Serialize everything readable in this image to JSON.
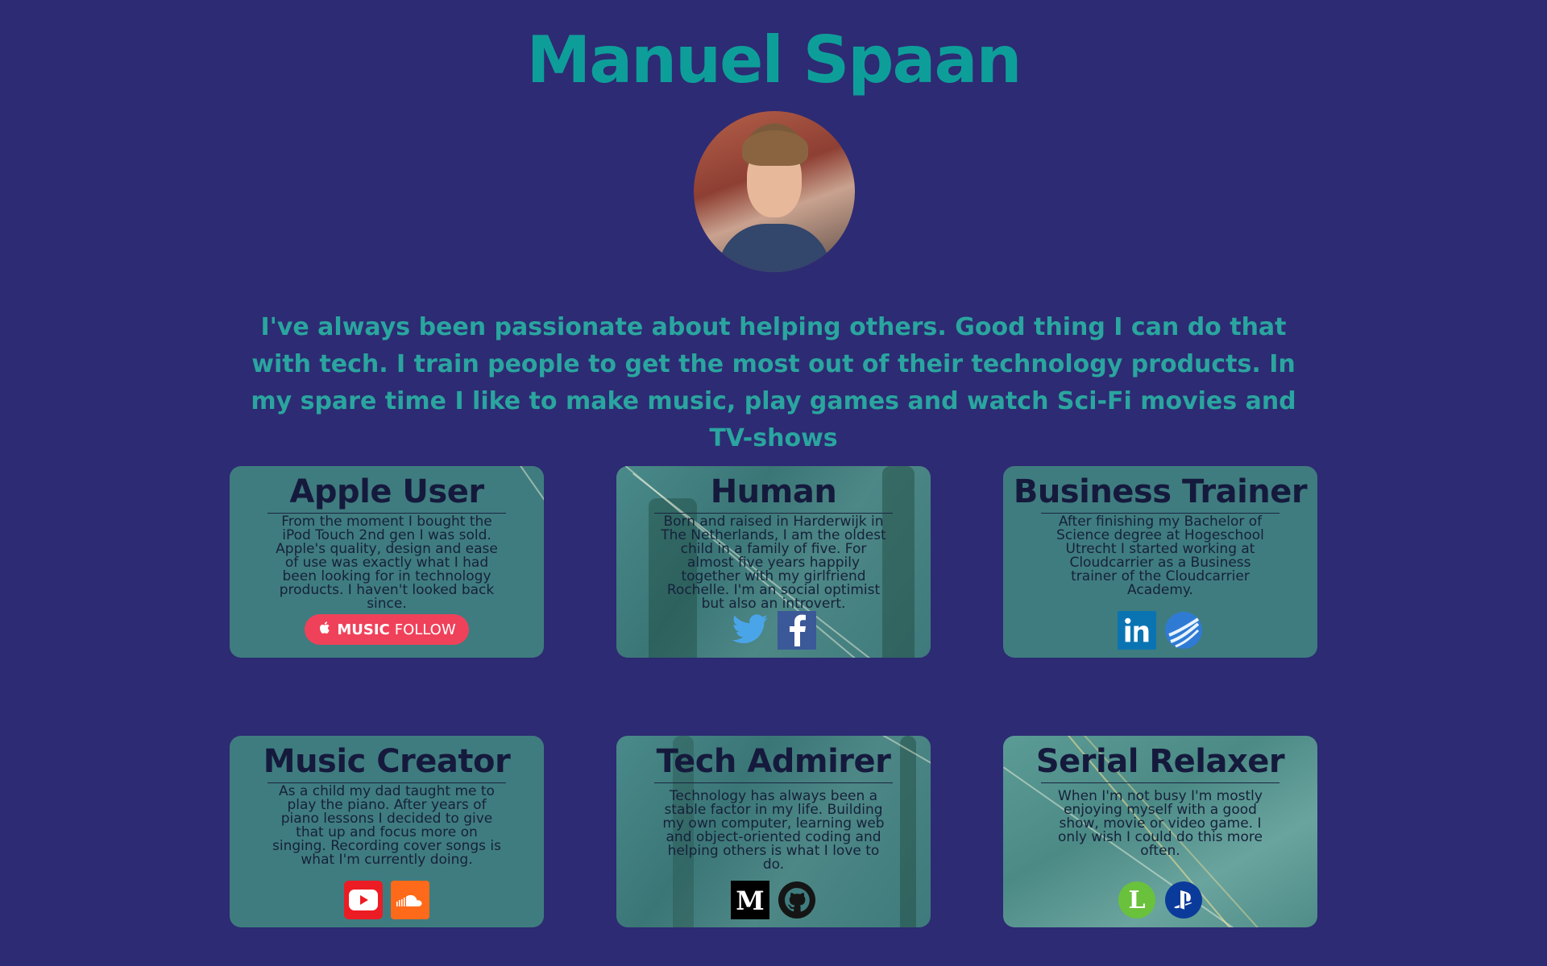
{
  "header": {
    "name": "Manuel Spaan",
    "bio": "I've always been passionate about helping others. Good thing I can do that with tech. I train people to get the most out of their technology products. In my spare time I like to make music, play games and watch Sci-Fi movies and TV-shows"
  },
  "cards": [
    {
      "title": "Apple User",
      "text": "From the moment I bought the iPod Touch 2nd gen I was sold. Apple's quality, design and ease of use was exactly what I had been looking for in technology products. I haven't looked back since.",
      "button": {
        "brand": "MUSIC",
        "label": "FOLLOW",
        "icon": "apple-logo-icon",
        "color": "#f0415a"
      }
    },
    {
      "title": "Human",
      "text": "Born and raised in Harderwijk in The Netherlands, I am the oldest child in a family of five. For almost five years happily together with my girlfriend Rochelle. I'm an social optimist but also an introvert.",
      "icons": [
        "twitter-icon",
        "facebook-icon"
      ]
    },
    {
      "title": "Business Trainer",
      "text": "After finishing my Bachelor of Science degree at Hogeschool Utrecht I started working at Cloudcarrier as a Business trainer of the Cloudcarrier Academy.",
      "icons": [
        "linkedin-icon",
        "cloudcarrier-globe-icon"
      ]
    },
    {
      "title": "Music Creator",
      "text": "As a child my dad taught me to play the piano. After years of piano lessons I decided to give that up and focus more on singing. Recording cover songs is what I'm currently doing.",
      "icons": [
        "youtube-icon",
        "soundcloud-icon"
      ]
    },
    {
      "title": "Tech Admirer",
      "text": "Technology has always been a stable factor in my life. Building my own computer, learning web and object-oriented coding and helping others is what I love to do.",
      "icons": [
        "medium-icon",
        "github-icon"
      ]
    },
    {
      "title": "Serial Relaxer",
      "text": "When I'm not busy I'm mostly enjoying myself with a good show, movie or video game. I only wish I could do this more often.",
      "icons": [
        "letterboxd-icon",
        "playstation-icon"
      ]
    }
  ],
  "colors": {
    "background": "#2d2b73",
    "accent": "#0e9e9a",
    "card": "#3f7c7f",
    "card_text": "#151a3d"
  }
}
